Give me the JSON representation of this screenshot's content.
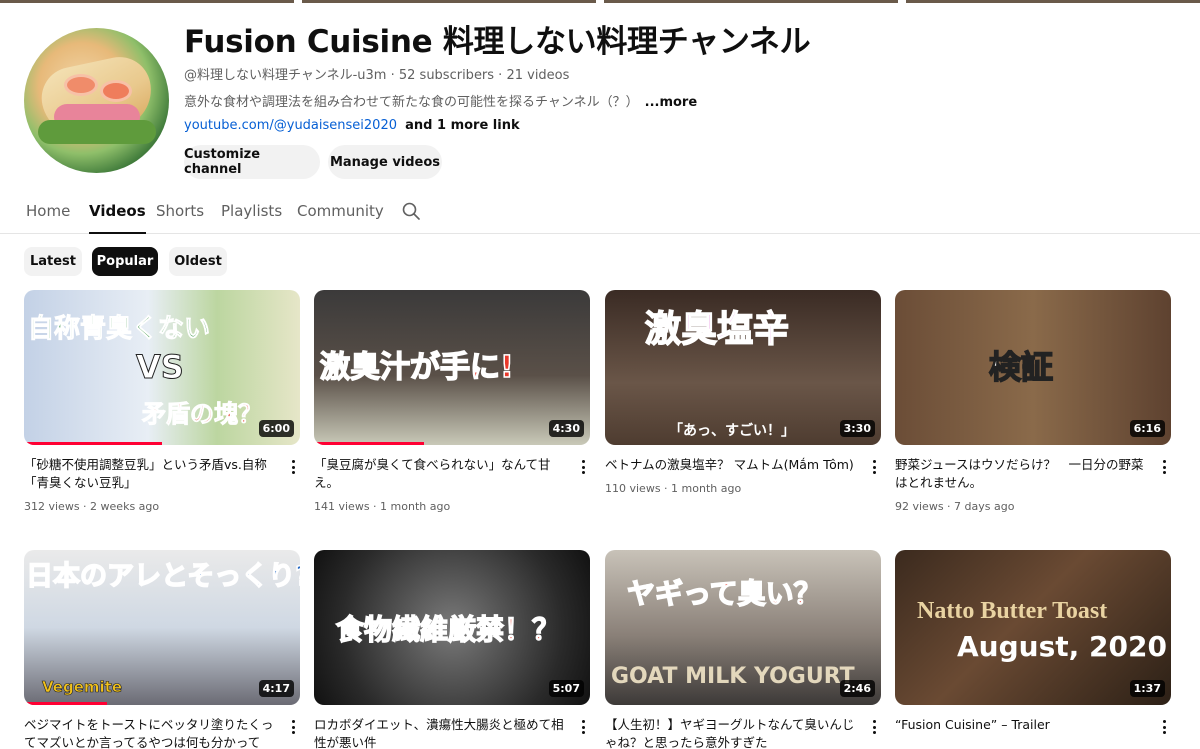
{
  "channel": {
    "title": "Fusion Cuisine 料理しない料理チャンネル",
    "meta": "@料理しない料理チャンネル-u3m · 52 subscribers · 21 videos",
    "description": "意外な食材や調理法を組み合わせて新たな食の可能性を探るチャンネル（？）",
    "description_more": "...more",
    "link": "youtube.com/@yudaisensei2020",
    "link_more": "and 1 more link",
    "customize_label": "Customize channel",
    "manage_label": "Manage videos"
  },
  "tabs": [
    {
      "label": "Home"
    },
    {
      "label": "Videos",
      "active": true
    },
    {
      "label": "Shorts"
    },
    {
      "label": "Playlists"
    },
    {
      "label": "Community"
    }
  ],
  "search_icon": "search-icon",
  "chips": [
    {
      "label": "Latest"
    },
    {
      "label": "Popular",
      "active": true
    },
    {
      "label": "Oldest"
    }
  ],
  "videos": [
    {
      "title": "「砂糖不使用調整豆乳」という矛盾vs.自称「青臭くない豆乳」",
      "meta": "312 views · 2 weeks ago",
      "duration": "6:00",
      "thumb_texts": [
        "自称青臭くない",
        "VS",
        "矛盾の塊？"
      ]
    },
    {
      "title": "「臭豆腐が臭くて食べられない」なんて甘え。",
      "meta": "141 views · 1 month ago",
      "duration": "4:30",
      "thumb_texts": [
        "激臭汁が手に!"
      ]
    },
    {
      "title": "ベトナムの激臭塩辛？ マムトム(Mắm Tôm)",
      "meta": "110 views · 1 month ago",
      "duration": "3:30",
      "thumb_texts": [
        "激臭塩辛",
        "「あっ、すごい！」"
      ]
    },
    {
      "title": "野菜ジュースはウソだらけ？　一日分の野菜はとれません。",
      "meta": "92 views · 7 days ago",
      "duration": "6:16",
      "thumb_texts": [
        "検証"
      ]
    },
    {
      "title": "ベジマイトをトーストにベッタリ塗りたくってマズいとか言ってるやつは何も分かって",
      "meta": "",
      "duration": "4:17",
      "thumb_texts": [
        "日本のアレとそっくり?",
        "Vegemite"
      ]
    },
    {
      "title": "ロカボダイエット、潰瘍性大腸炎と極めて相性が悪い件",
      "meta": "",
      "duration": "5:07",
      "thumb_texts": [
        "食物繊維厳禁！？"
      ]
    },
    {
      "title": "【人生初！】ヤギヨーグルトなんて臭いんじゃね？と思ったら意外すぎた",
      "meta": "",
      "duration": "2:46",
      "thumb_texts": [
        "ヤギって臭い？",
        "GOAT MILK YOGURT"
      ]
    },
    {
      "title": "“Fusion Cuisine” – Trailer",
      "meta": "",
      "duration": "1:37",
      "thumb_texts": [
        "Natto Butter Toast",
        "August, 2020"
      ]
    }
  ],
  "watch_progress": [
    0.5,
    0.4,
    0.0,
    0.0,
    0.3,
    0.0,
    0.0,
    0.0
  ]
}
